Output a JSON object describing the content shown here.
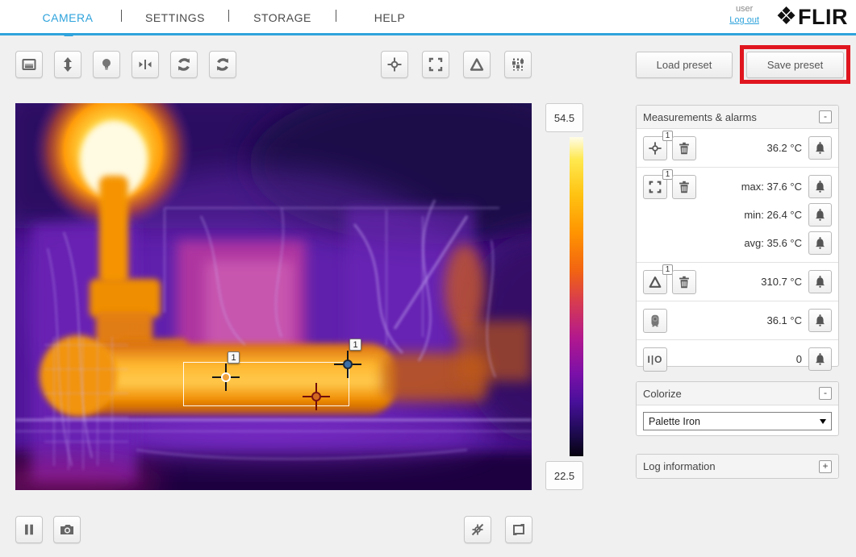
{
  "header": {
    "nav": [
      {
        "label": "CAMERA",
        "active": true
      },
      {
        "label": "SETTINGS",
        "active": false
      },
      {
        "label": "STORAGE",
        "active": false
      },
      {
        "label": "HELP",
        "active": false
      }
    ],
    "user_label": "user",
    "logout_label": "Log out",
    "brand": "FLIR",
    "brand_icon": "flir-diamond-icon"
  },
  "toolbar": {
    "left_icons": [
      "palette-window-icon",
      "pan-vertical-icon",
      "lamp-icon",
      "pan-horizontal-icon",
      "rotate-image-icon",
      "rotate-palette-icon"
    ],
    "center_icons": [
      "spot-meter-icon",
      "area-box-icon",
      "delta-icon",
      "levels-icon"
    ],
    "load_preset": "Load preset",
    "save_preset": "Save preset"
  },
  "scale": {
    "max_value": "54.5",
    "min_value": "22.5"
  },
  "measurements": {
    "title": "Measurements & alarms",
    "collapse": "-",
    "spot_badge": "1",
    "area_badge": "1",
    "delta_badge": "1",
    "io_label": "I|O",
    "spot_value": "36.2 °C",
    "area_max": "max: 37.6 °C",
    "area_min": "min: 26.4 °C",
    "area_avg": "avg: 35.6 °C",
    "delta_value": "310.7 °C",
    "camera_value": "36.1 °C",
    "io_value": "0"
  },
  "colorize": {
    "title": "Colorize",
    "collapse": "-",
    "palette": "Palette Iron"
  },
  "log_info": {
    "title": "Log information",
    "expand": "+"
  },
  "image_markers": {
    "spot_label": "1",
    "delta_label": "1"
  },
  "bottom_icons": [
    "pause-icon",
    "snapshot-icon",
    "hide-overlays-icon",
    "resize-icon"
  ],
  "colors": {
    "accent_blue": "#2fa3dc",
    "highlight_red": "#e0161f",
    "scale_hot": "#fffce8",
    "scale_cold": "#06020f"
  }
}
